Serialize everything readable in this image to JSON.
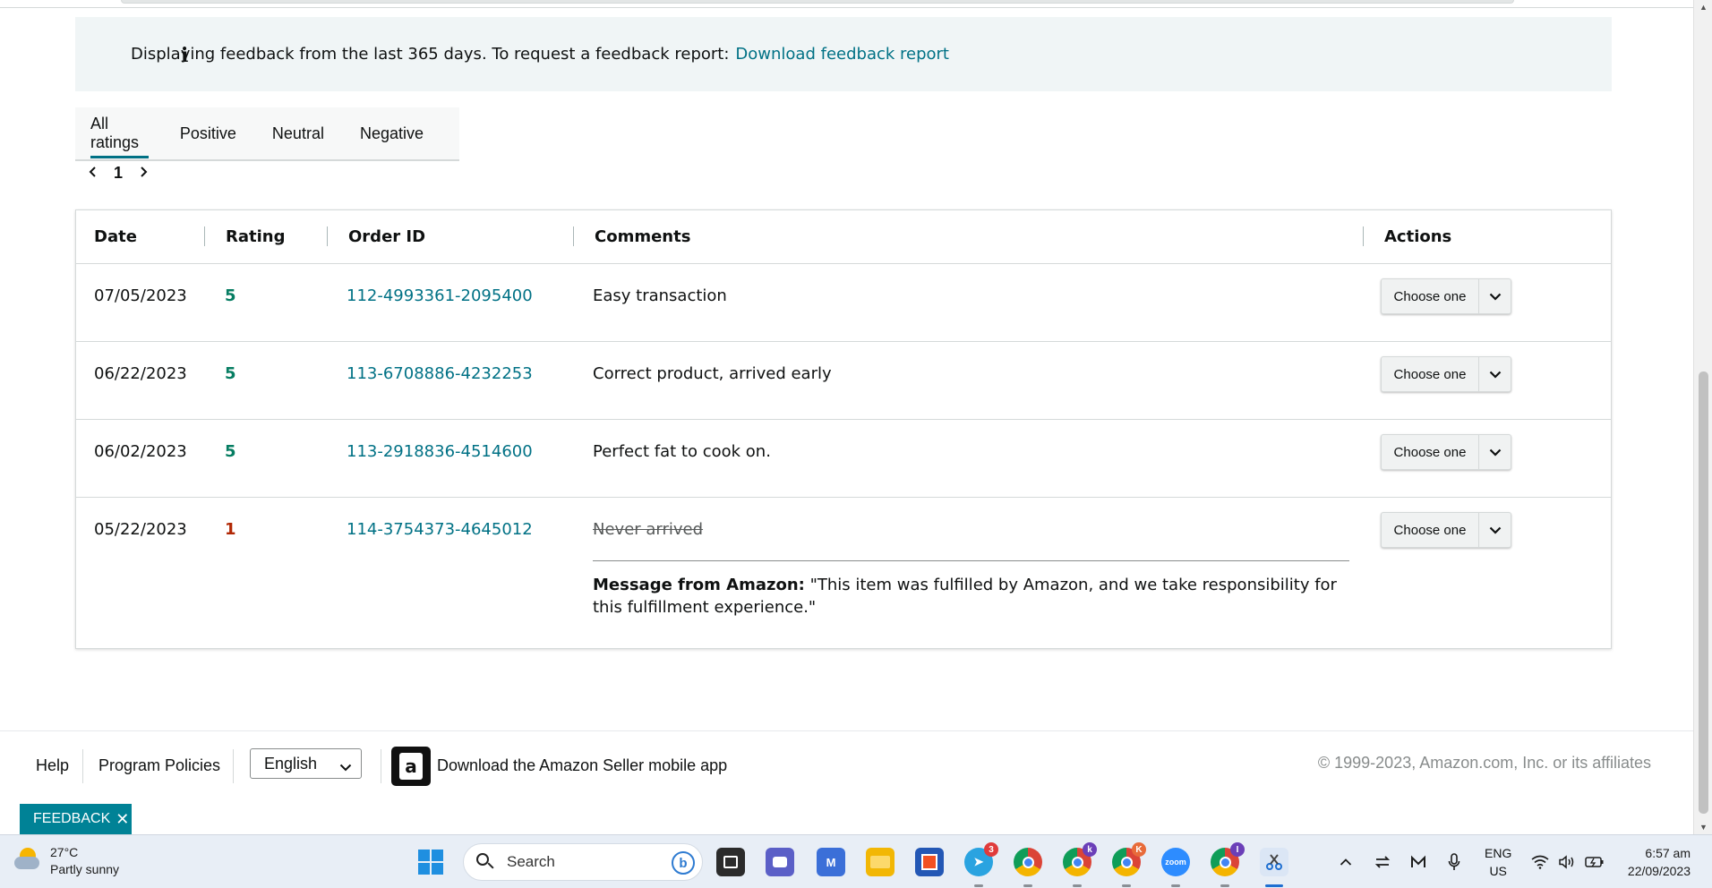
{
  "banner": {
    "message": "Displaying feedback from the last 365 days. To request a feedback report:",
    "link": "Download feedback report"
  },
  "tabs": [
    {
      "label": "All ratings",
      "active": true
    },
    {
      "label": "Positive",
      "active": false
    },
    {
      "label": "Neutral",
      "active": false
    },
    {
      "label": "Negative",
      "active": false
    }
  ],
  "pager": {
    "current_page": "1"
  },
  "table": {
    "headers": {
      "date": "Date",
      "rating": "Rating",
      "order_id": "Order ID",
      "comments": "Comments",
      "actions": "Actions"
    },
    "rows": [
      {
        "date": "07/05/2023",
        "rating": "5",
        "order_id": "112-4993361-2095400",
        "comment": "Easy transaction",
        "action": "Choose one"
      },
      {
        "date": "06/22/2023",
        "rating": "5",
        "order_id": "113-6708886-4232253",
        "comment": "Correct product, arrived early",
        "action": "Choose one"
      },
      {
        "date": "06/02/2023",
        "rating": "5",
        "order_id": "113-2918836-4514600",
        "comment": "Perfect fat to cook on.",
        "action": "Choose one"
      },
      {
        "date": "05/22/2023",
        "rating": "1",
        "order_id": "114-3754373-4645012",
        "comment": "Never arrived",
        "action": "Choose one",
        "amazon_message_label": "Message from Amazon:",
        "amazon_message": "\"This item was fulfilled by Amazon, and we take responsibility for this fulfillment experience.\""
      }
    ]
  },
  "footer": {
    "help": "Help",
    "policies": "Program Policies",
    "language": "English",
    "app_icon_letter": "a",
    "app_link": "Download the Amazon Seller mobile app",
    "copyright": "© 1999-2023, Amazon.com, Inc. or its affiliates"
  },
  "feedback_tab": {
    "label": "FEEDBACK",
    "close": "✕"
  },
  "taskbar": {
    "weather_temp": "27°C",
    "weather_desc": "Partly sunny",
    "search_placeholder": "Search",
    "telegram_badge": "3",
    "chrome2_badge": "k",
    "chrome3_badge": "K",
    "chrome4_badge": "I",
    "zoom_label": "zoom",
    "lang_line1": "ENG",
    "lang_line2": "US",
    "time": "6:57 am",
    "date": "22/09/2023"
  },
  "colors": {
    "link": "#007185",
    "positive_rating": "#067d62",
    "negative_rating": "#b12704",
    "feedback_tab": "#008296",
    "banner_bg": "#f0f5f6"
  }
}
